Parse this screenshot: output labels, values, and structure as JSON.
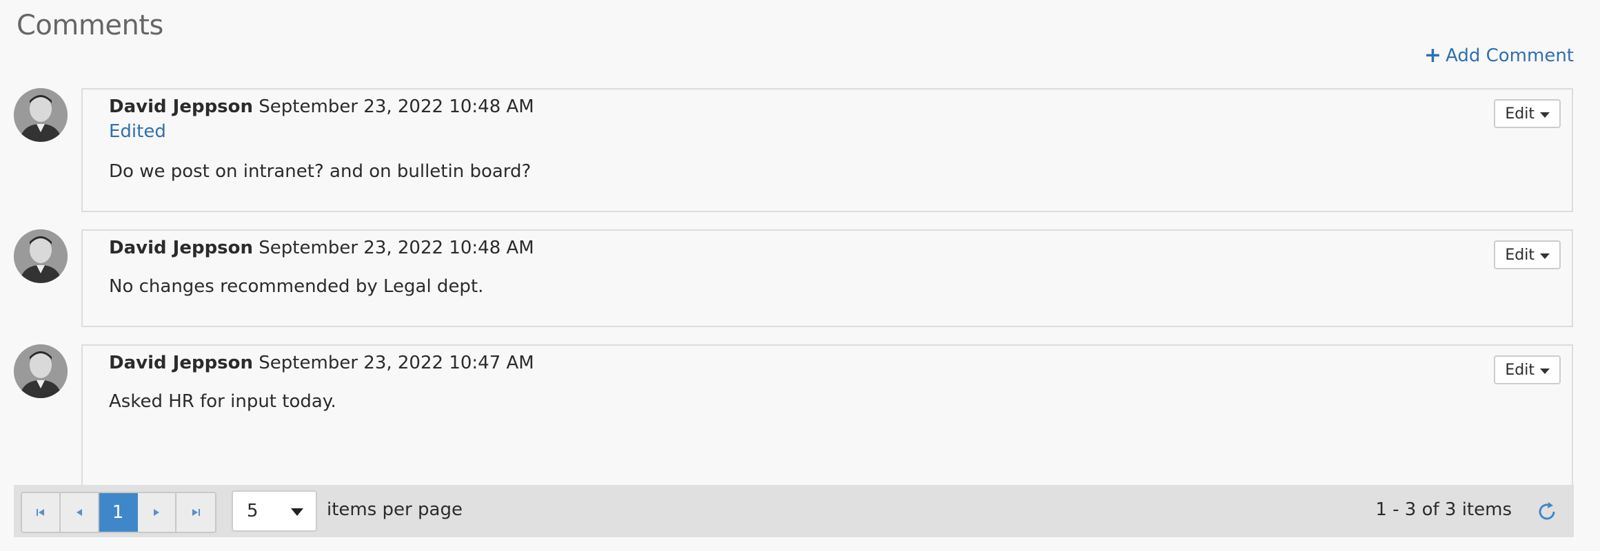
{
  "header": {
    "title": "Comments",
    "add_comment_label": "Add Comment"
  },
  "comments": [
    {
      "author": "David Jeppson",
      "timestamp": "September 23, 2022 10:48 AM",
      "edited_label": "Edited",
      "text": "Do we post on intranet? and on bulletin board?",
      "edit_label": "Edit"
    },
    {
      "author": "David Jeppson",
      "timestamp": "September 23, 2022 10:48 AM",
      "text": "No changes recommended by Legal dept.",
      "edit_label": "Edit"
    },
    {
      "author": "David Jeppson",
      "timestamp": "September 23, 2022 10:47 AM",
      "text": "Asked HR for input today.",
      "edit_label": "Edit"
    }
  ],
  "pager": {
    "current_page": "1",
    "page_size": "5",
    "per_page_label": "items per page",
    "range_label": "1 - 3 of 3 items"
  },
  "icons": {
    "add": "plus-icon",
    "first": "first-page-icon",
    "prev": "prev-page-icon",
    "next": "next-page-icon",
    "last": "last-page-icon",
    "refresh": "refresh-icon",
    "dropdown": "caret-down-icon"
  },
  "colors": {
    "accent": "#2f6fb0",
    "active_page": "#3f87c9"
  }
}
